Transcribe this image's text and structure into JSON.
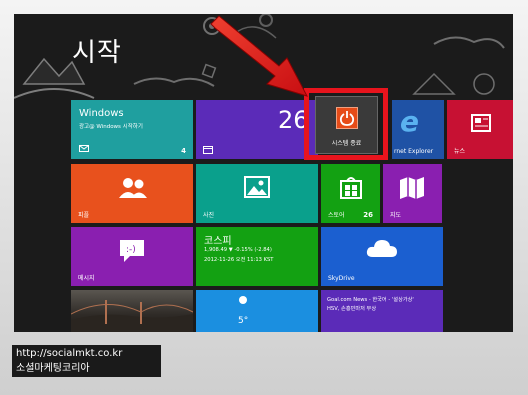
{
  "start": {
    "title": "시작"
  },
  "tiles": {
    "windows": {
      "title": "Windows",
      "subtitle": "광고@ Windows 시작하기",
      "count": "4"
    },
    "calendar": {
      "date": "26"
    },
    "ie": {
      "label": "rnet Explorer"
    },
    "news": {
      "label": "뉴스"
    },
    "people": {
      "label": "피플"
    },
    "photos": {
      "label": "사진"
    },
    "store": {
      "label": "스토어",
      "count": "26"
    },
    "maps": {
      "label": "지도"
    },
    "messaging": {
      "label": "메시지"
    },
    "kospi": {
      "title": "코스피",
      "line1": "1,908.49  ▼ -0.15% (-2.84)",
      "line2": "2012-11-26 오전 11:13 KST"
    },
    "skydrive": {
      "label": "SkyDrive"
    },
    "weather": {
      "temp": "5°"
    },
    "goal": {
      "line1": "Goal.com News - 한국어 - '설상가상'",
      "line2": "HSV, 손흥민마저 부상"
    }
  },
  "shutdown": {
    "label": "시스템 종료"
  },
  "caption": {
    "line1": "http://socialmkt.co.kr",
    "line2": "소셜마케팅코리아"
  },
  "colors": {
    "highlight": "#e8141d",
    "power": "#e64c18",
    "tile_blue": "#1b5fd0",
    "tile_purple": "#8a1fb0",
    "tile_orange": "#e8511d",
    "tile_green": "#13a112",
    "tile_teal": "#0aa08c",
    "tile_red": "#c71133",
    "tile_navy": "#1f52a5"
  }
}
